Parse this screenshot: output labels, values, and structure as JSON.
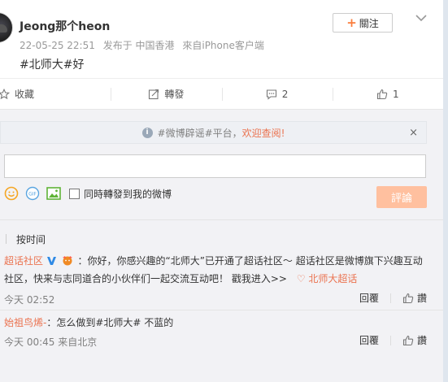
{
  "post": {
    "username": "Jeong那个heon",
    "timestamp": "22-05-25 22:51",
    "source_from": "发布于 中国香港",
    "source_device": "來自iPhone客户端",
    "text": "#北师大#好",
    "follow_label": "關注"
  },
  "actions": {
    "favorite": "收藏",
    "repost": "轉發",
    "comment_count": "2",
    "like_count": "1"
  },
  "notice": {
    "text": "#微博辟谣#平台，",
    "highlight": "欢迎查阅!",
    "close": "×"
  },
  "composer": {
    "share_label": "同時轉發到我的微博",
    "submit_label": "評論"
  },
  "sort": {
    "label": "按时间"
  },
  "comments": [
    {
      "nick": "超话社区",
      "text_a": "：你好，你感兴趣的“北师大”已开通了超话社区～ 超话社区是微博旗下兴趣互动社区，快来与志同道合的小伙伴们一起交流互动吧！",
      "cta": "戳我进入>>",
      "link": "北师大超话",
      "time": "今天 02:52",
      "reply": "回覆",
      "like": "讚"
    },
    {
      "nick": "始祖鸟烯-",
      "text_a": "：怎么做到#北师大# 不蓝的",
      "time": "今天 00:45 来自北京",
      "reply": "回覆",
      "like": "讚"
    }
  ],
  "colors": {
    "accent": "#eb7350",
    "submit_disabled": "#ffc09f",
    "follow_plus": "#fa7d3c",
    "vip_badge": "#2f8ae5"
  }
}
